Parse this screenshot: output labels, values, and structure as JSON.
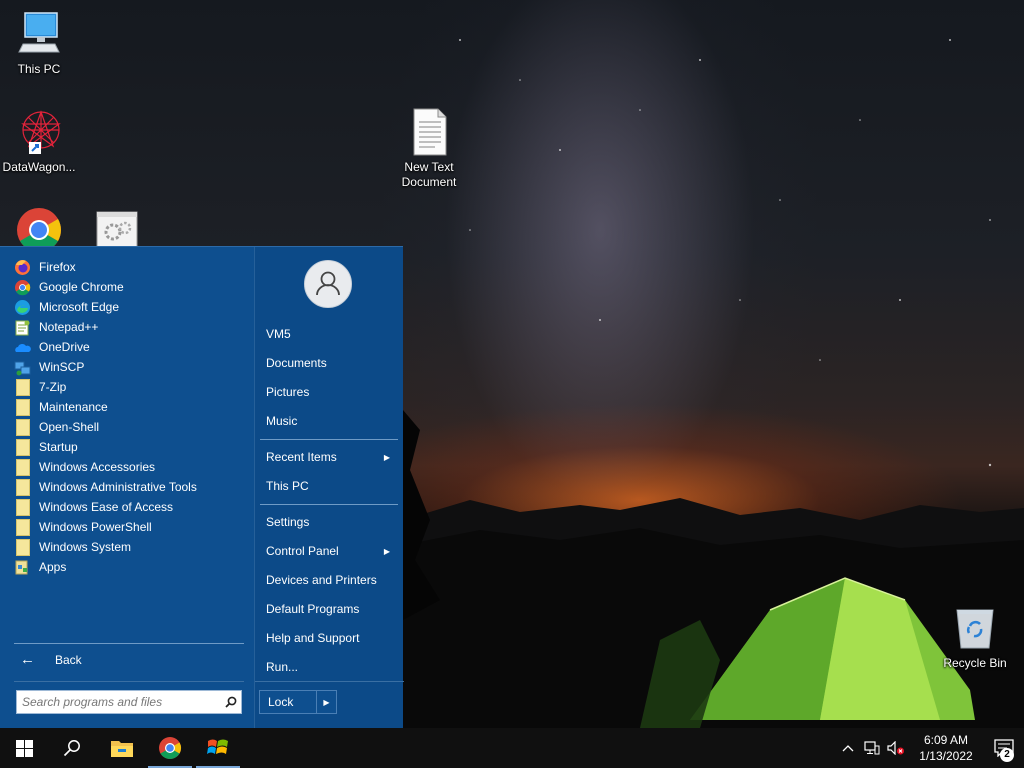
{
  "desktop": {
    "icons": [
      {
        "label": "This PC",
        "icon": "this-pc-icon"
      },
      {
        "label": "DataWagon...",
        "icon": "datawagon-icon"
      },
      {
        "label": "New Text Document",
        "icon": "text-document-icon"
      },
      {
        "label": "Recycle Bin",
        "icon": "recycle-bin-icon"
      }
    ],
    "partial_icons": [
      "chrome-icon",
      "settings-app-icon"
    ]
  },
  "start_menu": {
    "programs": [
      {
        "label": "Firefox",
        "icon": "firefox-icon"
      },
      {
        "label": "Google Chrome",
        "icon": "chrome-icon"
      },
      {
        "label": "Microsoft Edge",
        "icon": "edge-icon"
      },
      {
        "label": "Notepad++",
        "icon": "notepadpp-icon"
      },
      {
        "label": "OneDrive",
        "icon": "onedrive-icon"
      },
      {
        "label": "WinSCP",
        "icon": "winscp-icon"
      },
      {
        "label": "7-Zip",
        "icon": "folder-icon"
      },
      {
        "label": "Maintenance",
        "icon": "folder-icon"
      },
      {
        "label": "Open-Shell",
        "icon": "folder-icon"
      },
      {
        "label": "Startup",
        "icon": "folder-icon"
      },
      {
        "label": "Windows Accessories",
        "icon": "folder-icon"
      },
      {
        "label": "Windows Administrative Tools",
        "icon": "folder-icon"
      },
      {
        "label": "Windows Ease of Access",
        "icon": "folder-icon"
      },
      {
        "label": "Windows PowerShell",
        "icon": "folder-icon"
      },
      {
        "label": "Windows System",
        "icon": "folder-icon"
      },
      {
        "label": "Apps",
        "icon": "apps-icon"
      }
    ],
    "back_label": "Back",
    "search_placeholder": "Search programs and files",
    "right": {
      "user": "VM5",
      "items": [
        "Documents",
        "Pictures",
        "Music"
      ],
      "recent_items": "Recent Items",
      "this_pc": "This PC",
      "settings": "Settings",
      "control_panel": "Control Panel",
      "devices_printers": "Devices and Printers",
      "default_programs": "Default Programs",
      "help_support": "Help and Support",
      "run": "Run..."
    },
    "lock_label": "Lock"
  },
  "taskbar": {
    "pinned": [
      "start-icon",
      "search-icon",
      "file-explorer-icon",
      "chrome-icon",
      "open-shell-icon"
    ],
    "tray": {
      "time": "6:09 AM",
      "date": "1/13/2022",
      "notifications": "2"
    }
  },
  "colors": {
    "start_menu_bg": "#0e4f8f",
    "taskbar_bg": "#101010"
  }
}
